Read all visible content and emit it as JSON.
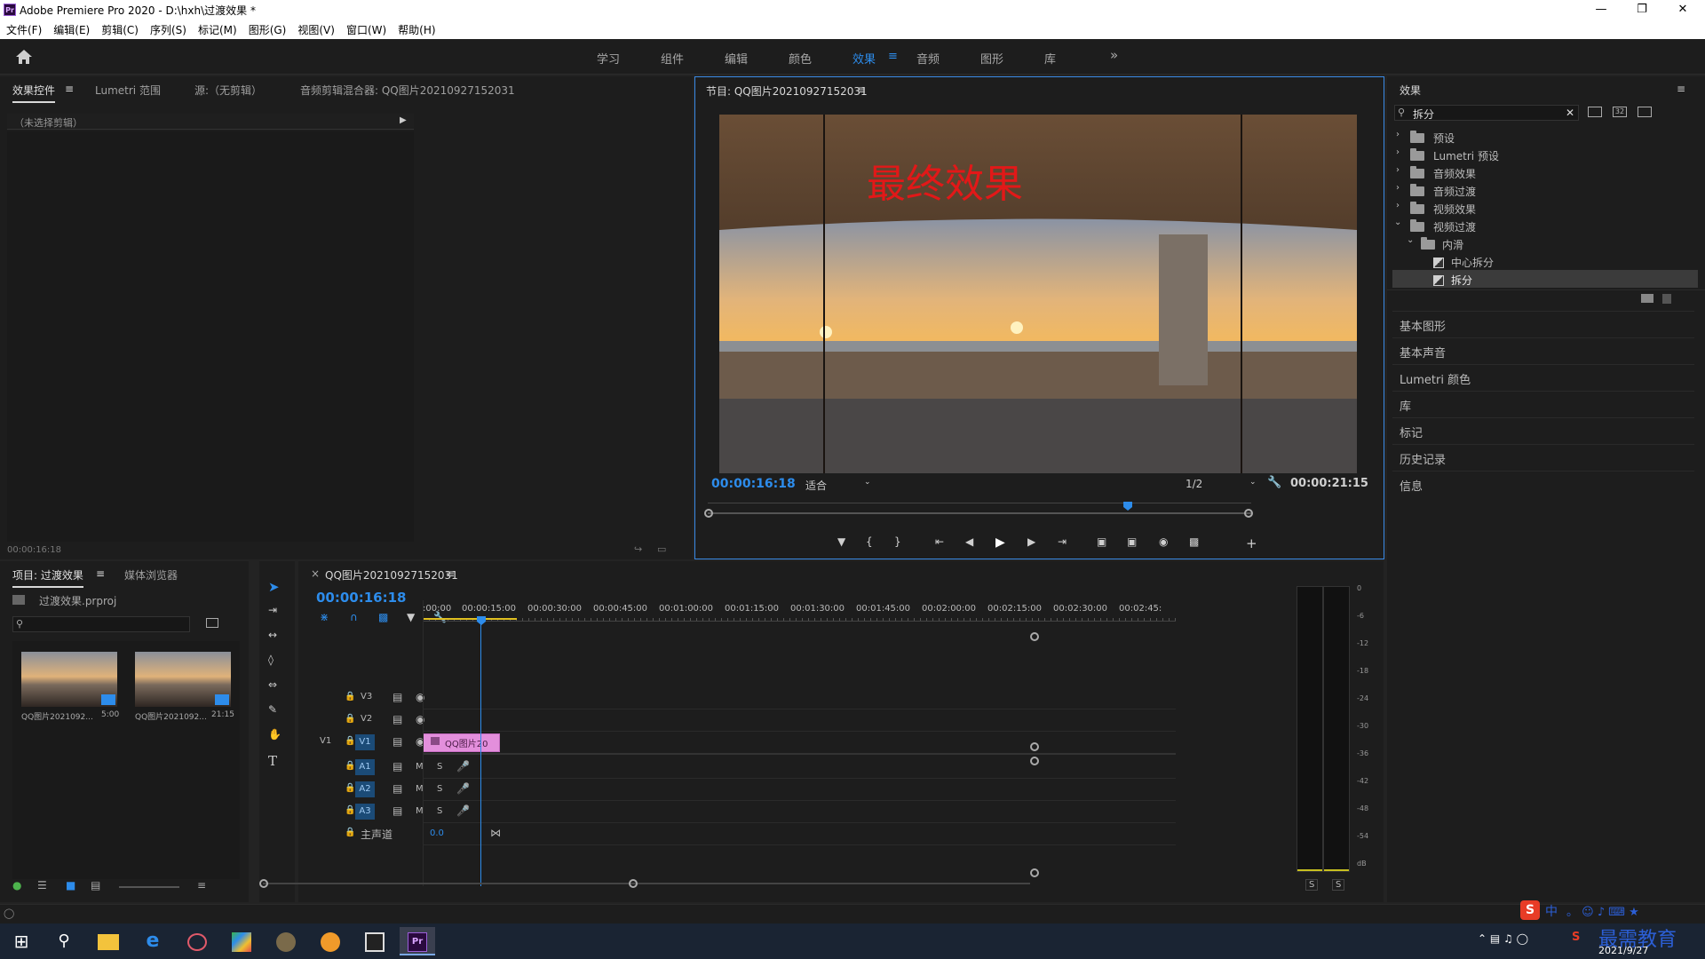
{
  "window": {
    "title": "Adobe Premiere Pro 2020 - D:\\hxh\\过渡效果 *",
    "logo": "Pr"
  },
  "menu": [
    "文件(F)",
    "编辑(E)",
    "剪辑(C)",
    "序列(S)",
    "标记(M)",
    "图形(G)",
    "视图(V)",
    "窗口(W)",
    "帮助(H)"
  ],
  "workspaces": {
    "items": [
      "学习",
      "组件",
      "编辑",
      "颜色",
      "效果",
      "音频",
      "图形",
      "库"
    ],
    "active": "效果",
    "more": "»"
  },
  "effect_controls": {
    "tabs": [
      "效果控件",
      "Lumetri 范围",
      "源:（无剪辑）",
      "音频剪辑混合器: QQ图片20210927152031"
    ],
    "no_clip": "（未选择剪辑）",
    "timecode": "00:00:16:18"
  },
  "program_monitor": {
    "tab": "节目: QQ图片20210927152031",
    "overlay_text": "最终效果",
    "timecode": "00:00:16:18",
    "fit": "适合",
    "resolution": "1/2",
    "duration": "00:00:21:15",
    "playhead_fraction": 0.773
  },
  "effects_panel": {
    "title": "效果",
    "search_value": "拆分",
    "tree": [
      {
        "label": "预设",
        "kind": "folder-special"
      },
      {
        "label": "Lumetri 预设",
        "kind": "folder-special"
      },
      {
        "label": "音频效果",
        "kind": "folder"
      },
      {
        "label": "音频过渡",
        "kind": "folder"
      },
      {
        "label": "视频效果",
        "kind": "folder"
      },
      {
        "label": "视频过渡",
        "kind": "folder",
        "open": true
      },
      {
        "label": "内滑",
        "kind": "folder",
        "open": true,
        "level": 1
      },
      {
        "label": "中心拆分",
        "kind": "fx",
        "level": 2
      },
      {
        "label": "拆分",
        "kind": "fx",
        "level": 2,
        "selected": true
      }
    ],
    "sections": [
      "基本图形",
      "基本声音",
      "Lumetri 颜色",
      "库",
      "标记",
      "历史记录",
      "信息"
    ]
  },
  "project": {
    "tabs": [
      "项目: 过渡效果",
      "媒体浏览器"
    ],
    "file": "过渡效果.prproj",
    "items": [
      {
        "name": "QQ图片2021092...",
        "duration": "5:00"
      },
      {
        "name": "QQ图片2021092...",
        "duration": "21:15"
      }
    ]
  },
  "timeline": {
    "tab": "QQ图片20210927152031",
    "timecode": "00:00:16:18",
    "ruler": [
      ":00:00",
      "00:00:15:00",
      "00:00:30:00",
      "00:00:45:00",
      "00:01:00:00",
      "00:01:15:00",
      "00:01:30:00",
      "00:01:45:00",
      "00:02:00:00",
      "00:02:15:00",
      "00:02:30:00",
      "00:02:45:"
    ],
    "tracks": {
      "video": [
        "V3",
        "V2",
        "V1"
      ],
      "audio": [
        "A1",
        "A2",
        "A3"
      ],
      "source_patch": "V1",
      "mute": "M",
      "solo": "S",
      "master": "主声道",
      "master_value": "0.0"
    },
    "clip": {
      "label": "QQ图片20",
      "color": "#e38fdc"
    }
  },
  "audio_meter": {
    "scale": [
      "0",
      "-6",
      "-12",
      "-18",
      "-24",
      "-30",
      "-36",
      "-42",
      "-48",
      "-54",
      "dB"
    ],
    "solo": [
      "S",
      "S"
    ]
  },
  "tray": {
    "date": "2021/9/27",
    "watermark": "最需教育",
    "ime": "中"
  },
  "colors": {
    "accent": "#2d8ceb",
    "panel": "#1d1d1d",
    "clip": "#e38fdc",
    "overlay_text": "#e21818"
  }
}
